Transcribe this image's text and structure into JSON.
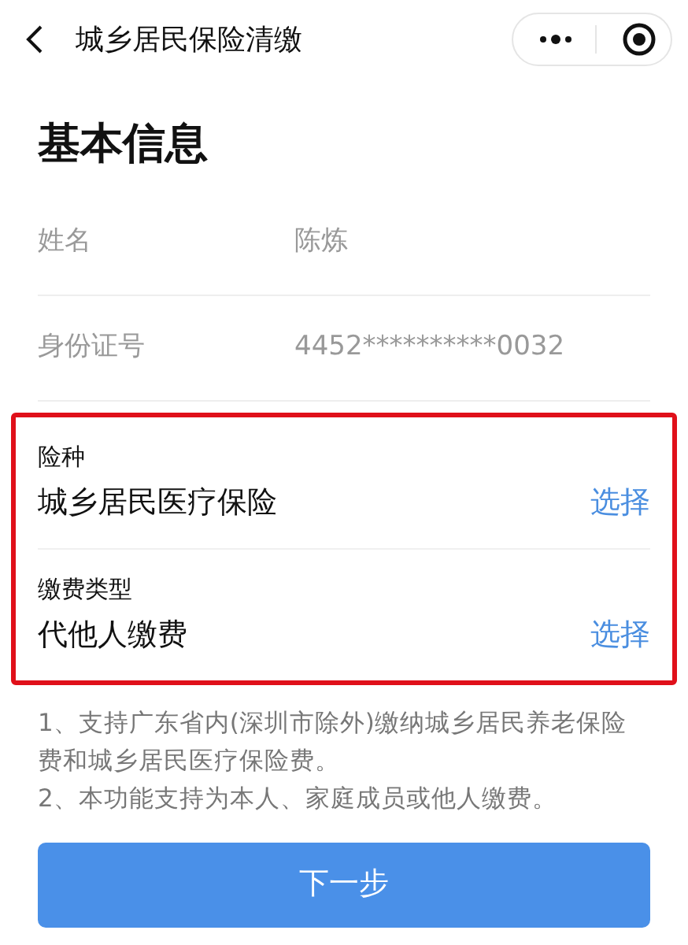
{
  "nav": {
    "title": "城乡居民保险清缴"
  },
  "section_title": "基本信息",
  "info_rows": [
    {
      "label": "姓名",
      "value": "陈炼"
    },
    {
      "label": "身份证号",
      "value": "4452**********0032"
    }
  ],
  "highlighted_fields": [
    {
      "label": "险种",
      "value": "城乡居民医疗保险",
      "action": "选择"
    },
    {
      "label": "缴费类型",
      "value": "代他人缴费",
      "action": "选择"
    }
  ],
  "notes": [
    "1、支持广东省内(深圳市除外)缴纳城乡居民养老保险费和城乡居民医疗保险费。",
    "2、本功能支持为本人、家庭成员或他人缴费。"
  ],
  "primary_button": "下一步"
}
